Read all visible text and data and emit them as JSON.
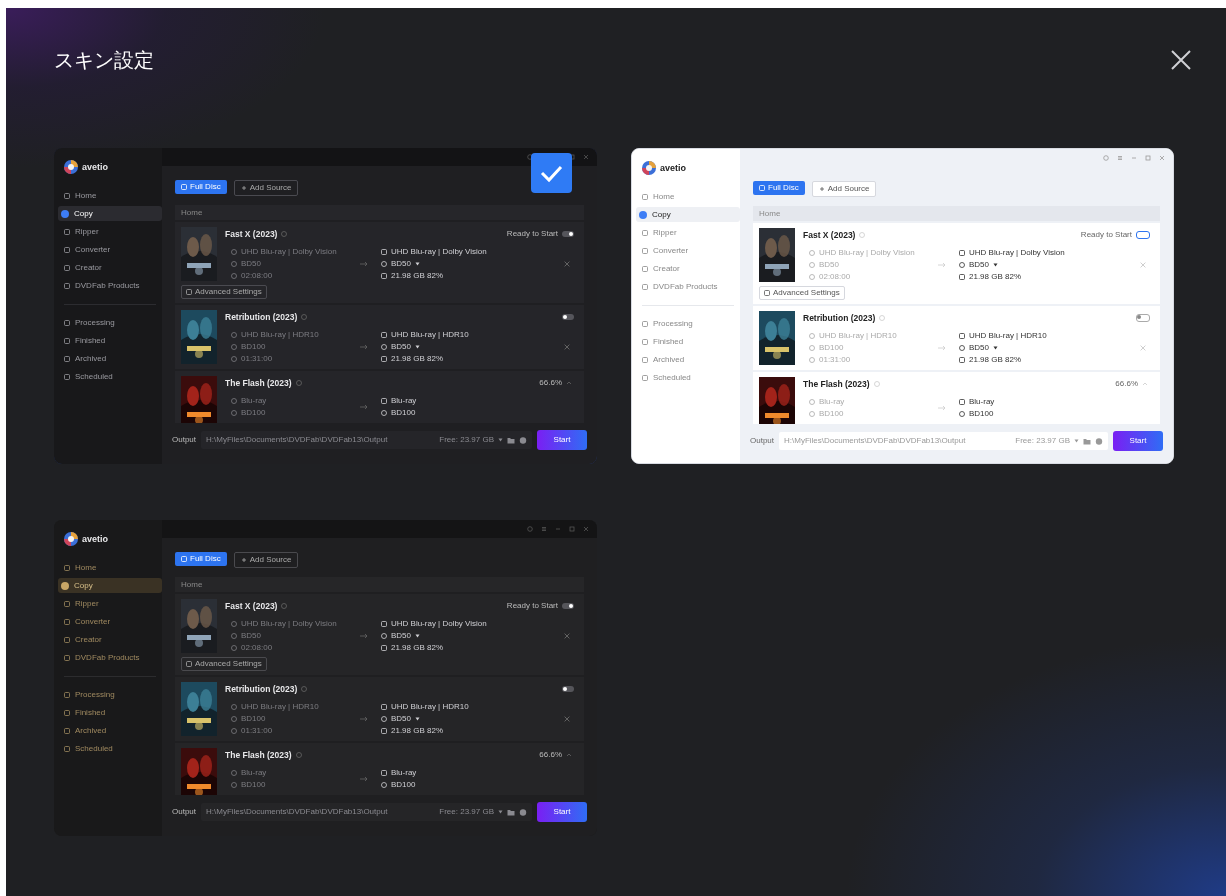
{
  "dialog": {
    "title": "スキン設定"
  },
  "skins": [
    {
      "kind": "dark-blue",
      "selected": true,
      "preview": {
        "brand": "avetio",
        "nav": [
          {
            "label": "Home",
            "selected": false
          },
          {
            "label": "Copy",
            "selected": true
          },
          {
            "label": "Ripper",
            "selected": false
          },
          {
            "label": "Converter",
            "selected": false
          },
          {
            "label": "Creator",
            "selected": false
          },
          {
            "label": "DVDFab Products",
            "selected": false
          }
        ],
        "queue": [
          {
            "label": "Processing"
          },
          {
            "label": "Finished"
          },
          {
            "label": "Archived"
          },
          {
            "label": "Scheduled"
          }
        ],
        "buttons": [
          "Full Disc",
          "Add Source"
        ],
        "breadcrumb": "Home",
        "titles": [
          {
            "name": "Fast X (2023)",
            "status": "Ready to Start",
            "toggle_on": true,
            "source": [
              "UHD Blu-ray | Dolby Vision",
              "BD50",
              "02:08:00"
            ],
            "target": [
              "UHD Blu-ray | Dolby Vision",
              "BD50",
              "21.98 GB  82%"
            ],
            "advanced": "Advanced Settings"
          },
          {
            "name": "Retribution (2023)",
            "toggle_on": false,
            "source": [
              "UHD Blu-ray | HDR10",
              "BD100",
              "01:31:00"
            ],
            "target": [
              "UHD Blu-ray | HDR10",
              "BD50",
              "21.98 GB  82%"
            ]
          },
          {
            "name": "The Flash (2023)",
            "status": "66.6%",
            "source": [
              "Blu-ray",
              "BD100"
            ],
            "target": [
              "Blu-ray",
              "BD100"
            ]
          }
        ],
        "output": {
          "label": "Output",
          "path": "H:\\MyFiles\\Documents\\DVDFab\\DVDFab13\\Output",
          "free": "Free: 23.97 GB",
          "button": "Start"
        }
      }
    },
    {
      "kind": "light",
      "selected": false,
      "preview": {
        "brand": "avetio",
        "nav": [
          {
            "label": "Home",
            "selected": false
          },
          {
            "label": "Copy",
            "selected": true
          },
          {
            "label": "Ripper",
            "selected": false
          },
          {
            "label": "Converter",
            "selected": false
          },
          {
            "label": "Creator",
            "selected": false
          },
          {
            "label": "DVDFab Products",
            "selected": false
          }
        ],
        "queue": [
          {
            "label": "Processing"
          },
          {
            "label": "Finished"
          },
          {
            "label": "Archived"
          },
          {
            "label": "Scheduled"
          }
        ],
        "buttons": [
          "Full Disc",
          "Add Source"
        ],
        "breadcrumb": "Home",
        "titles": [
          {
            "name": "Fast X (2023)",
            "status": "Ready to Start",
            "toggle_on": true,
            "source": [
              "UHD Blu-ray | Dolby Vision",
              "BD50",
              "02:08:00"
            ],
            "target": [
              "UHD Blu-ray | Dolby Vision",
              "BD50",
              "21.98 GB  82%"
            ],
            "advanced": "Advanced Settings"
          },
          {
            "name": "Retribution (2023)",
            "toggle_on": false,
            "source": [
              "UHD Blu-ray | HDR10",
              "BD100",
              "01:31:00"
            ],
            "target": [
              "UHD Blu-ray | HDR10",
              "BD50",
              "21.98 GB  82%"
            ]
          },
          {
            "name": "The Flash (2023)",
            "status": "66.6%",
            "source": [
              "Blu-ray",
              "BD100"
            ],
            "target": [
              "Blu-ray",
              "BD100"
            ]
          }
        ],
        "output": {
          "label": "Output",
          "path": "H:\\MyFiles\\Documents\\DVDFab\\DVDFab13\\Output",
          "free": "Free: 23.97 GB",
          "button": "Start"
        }
      }
    },
    {
      "kind": "dark-gold",
      "selected": false,
      "preview": {
        "brand": "avetio",
        "nav": [
          {
            "label": "Home",
            "selected": false
          },
          {
            "label": "Copy",
            "selected": true
          },
          {
            "label": "Ripper",
            "selected": false
          },
          {
            "label": "Converter",
            "selected": false
          },
          {
            "label": "Creator",
            "selected": false
          },
          {
            "label": "DVDFab Products",
            "selected": false
          }
        ],
        "queue": [
          {
            "label": "Processing"
          },
          {
            "label": "Finished"
          },
          {
            "label": "Archived"
          },
          {
            "label": "Scheduled"
          }
        ],
        "buttons": [
          "Full Disc",
          "Add Source"
        ],
        "breadcrumb": "Home",
        "titles": [
          {
            "name": "Fast X (2023)",
            "status": "Ready to Start",
            "toggle_on": true,
            "source": [
              "UHD Blu-ray | Dolby Vision",
              "BD50",
              "02:08:00"
            ],
            "target": [
              "UHD Blu-ray | Dolby Vision",
              "BD50",
              "21.98 GB  82%"
            ],
            "advanced": "Advanced Settings"
          },
          {
            "name": "Retribution (2023)",
            "toggle_on": false,
            "source": [
              "UHD Blu-ray | HDR10",
              "BD100",
              "01:31:00"
            ],
            "target": [
              "UHD Blu-ray | HDR10",
              "BD50",
              "21.98 GB  82%"
            ]
          },
          {
            "name": "The Flash (2023)",
            "status": "66.6%",
            "source": [
              "Blu-ray",
              "BD100"
            ],
            "target": [
              "Blu-ray",
              "BD100"
            ]
          }
        ],
        "output": {
          "label": "Output",
          "path": "H:\\MyFiles\\Documents\\DVDFab\\DVDFab13\\Output",
          "free": "Free: 23.97 GB",
          "button": "Start"
        }
      }
    }
  ]
}
